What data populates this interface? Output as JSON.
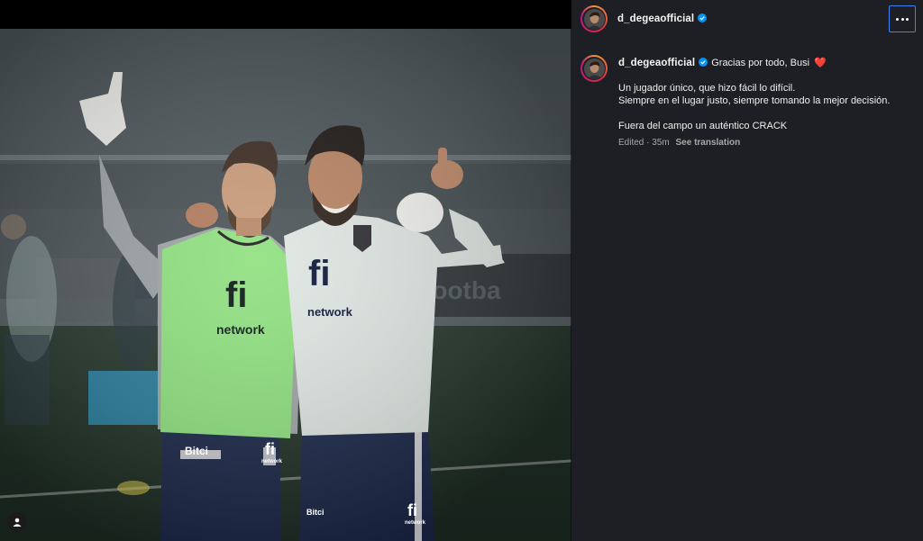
{
  "post": {
    "username": "d_degeaofficial",
    "verified": true,
    "caption": {
      "first_line": "Gracias por todo, Busi",
      "heart": "❤️",
      "lines": [
        "Un jugador único, que hizo fácil lo difícil.",
        "Siempre en el lugar justo, siempre tomando la mejor decisión."
      ],
      "closing": "Fuera del campo un auténtico CRACK"
    },
    "edited_label": "Edited",
    "separator": "·",
    "time_ago": "35m",
    "translate_label": "See translation"
  },
  "photo": {
    "left_bib_logo": "fi",
    "left_bib_text": "network",
    "right_shirt_logo": "fi",
    "right_shirt_text": "network",
    "shorts_sponsor": "Bitci",
    "shorts_logo_left": "fi",
    "shorts_logo_left_text": "network",
    "shorts_logo_right": "fi",
    "shorts_logo_right_text": "network",
    "shorts_sponsor_right": "Bitci"
  },
  "colors": {
    "panel_bg": "#1e1f24",
    "accent_blue": "#3b82f6",
    "verified_blue": "#0095f6",
    "muted_text": "#a8a8a8",
    "heart_red": "#ff3040",
    "bib_green": "#8ee07e"
  },
  "icons": {
    "more": "more-options-icon",
    "verified": "verified-badge-icon",
    "tags": "user-tag-icon"
  }
}
